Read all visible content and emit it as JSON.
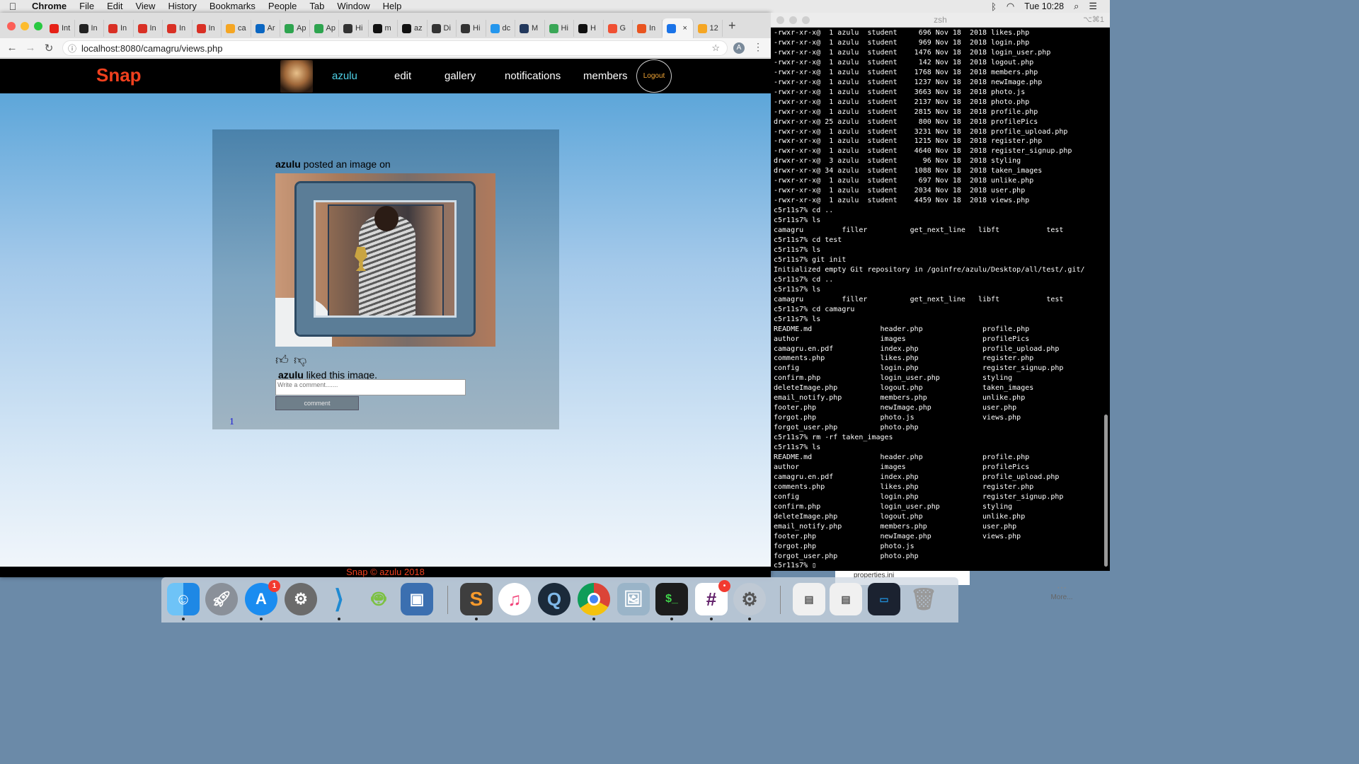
{
  "menubar": {
    "app": "Chrome",
    "items": [
      "File",
      "Edit",
      "View",
      "History",
      "Bookmarks",
      "People",
      "Tab",
      "Window",
      "Help"
    ],
    "clock": "Tue 10:28"
  },
  "browser": {
    "tabs": [
      {
        "label": "Int",
        "icon": "youtube-icon",
        "color": "#e62117"
      },
      {
        "label": "In",
        "icon": "42-icon",
        "color": "#222222"
      },
      {
        "label": "In",
        "icon": "gmail-icon",
        "color": "#d93025"
      },
      {
        "label": "In",
        "icon": "gmail-icon",
        "color": "#d93025"
      },
      {
        "label": "In",
        "icon": "gmail-icon",
        "color": "#d93025"
      },
      {
        "label": "In",
        "icon": "gmail-icon",
        "color": "#d93025"
      },
      {
        "label": "ca",
        "icon": "flame-icon",
        "color": "#f5a623"
      },
      {
        "label": "Ar",
        "icon": "linkedin-icon",
        "color": "#0a66c2"
      },
      {
        "label": "Ap",
        "icon": "h-icon",
        "color": "#2ea44f"
      },
      {
        "label": "Ap",
        "icon": "h-icon",
        "color": "#2ea44f"
      },
      {
        "label": "Hi",
        "icon": "circle-icon",
        "color": "#333333"
      },
      {
        "label": "m",
        "icon": "github-icon",
        "color": "#111111"
      },
      {
        "label": "az",
        "icon": "github-icon",
        "color": "#111111"
      },
      {
        "label": "Di",
        "icon": "circle-icon",
        "color": "#333333"
      },
      {
        "label": "Hi",
        "icon": "circle-icon",
        "color": "#333333"
      },
      {
        "label": "dc",
        "icon": "docker-icon",
        "color": "#2496ed"
      },
      {
        "label": "M",
        "icon": "m-icon",
        "color": "#23395d"
      },
      {
        "label": "Hi",
        "icon": "h-icon",
        "color": "#3aa757"
      },
      {
        "label": "H",
        "icon": "github-icon",
        "color": "#111111"
      },
      {
        "label": "G",
        "icon": "git-icon",
        "color": "#f05033"
      },
      {
        "label": "In",
        "icon": "ubuntu-icon",
        "color": "#e95420"
      },
      {
        "label": "",
        "icon": "refresh-icon",
        "color": "#1a73e8"
      },
      {
        "label": "12",
        "icon": "chart-icon",
        "color": "#f5a623"
      }
    ],
    "active_tab_close": "×",
    "new_tab": "+",
    "url": "localhost:8080/camagru/views.php",
    "profile_initial": "A"
  },
  "site": {
    "logo": "Snap",
    "nav": {
      "user": "azulu",
      "edit": "edit",
      "gallery": "gallery",
      "notifications": "notifications",
      "members": "members",
      "logout": "Logout"
    },
    "post": {
      "author": "azulu",
      "action": " posted an image on",
      "liker": "azulu",
      "liked_text": " liked this image.",
      "comment_placeholder": "Write a comment.......",
      "comment_button": "comment"
    },
    "page_number": "1",
    "footer": "Snap © azulu 2018",
    "colors": {
      "logo": "#f0401e",
      "active_nav": "#4fd2e8",
      "logout": "#f2a535"
    }
  },
  "terminal": {
    "title": "zsh",
    "shortcut": "⌥⌘1",
    "lines": [
      "-rwxr-xr-x@  1 azulu  student     696 Nov 18  2018 likes.php",
      "-rwxr-xr-x@  1 azulu  student     969 Nov 18  2018 login.php",
      "-rwxr-xr-x@  1 azulu  student    1476 Nov 18  2018 login_user.php",
      "-rwxr-xr-x@  1 azulu  student     142 Nov 18  2018 logout.php",
      "-rwxr-xr-x@  1 azulu  student    1768 Nov 18  2018 members.php",
      "-rwxr-xr-x@  1 azulu  student    1237 Nov 18  2018 newImage.php",
      "-rwxr-xr-x@  1 azulu  student    3663 Nov 18  2018 photo.js",
      "-rwxr-xr-x@  1 azulu  student    2137 Nov 18  2018 photo.php",
      "-rwxr-xr-x@  1 azulu  student    2815 Nov 18  2018 profile.php",
      "drwxr-xr-x@ 25 azulu  student     800 Nov 18  2018 profilePics",
      "-rwxr-xr-x@  1 azulu  student    3231 Nov 18  2018 profile_upload.php",
      "-rwxr-xr-x@  1 azulu  student    1215 Nov 18  2018 register.php",
      "-rwxr-xr-x@  1 azulu  student    4640 Nov 18  2018 register_signup.php",
      "drwxr-xr-x@  3 azulu  student      96 Nov 18  2018 styling",
      "drwxr-xr-x@ 34 azulu  student    1088 Nov 18  2018 taken_images",
      "-rwxr-xr-x@  1 azulu  student     697 Nov 18  2018 unlike.php",
      "-rwxr-xr-x@  1 azulu  student    2034 Nov 18  2018 user.php",
      "-rwxr-xr-x@  1 azulu  student    4459 Nov 18  2018 views.php",
      "c5r11s7% cd ..",
      "c5r11s7% ls",
      "camagru         filler          get_next_line   libft           test",
      "c5r11s7% cd test",
      "c5r11s7% ls",
      "c5r11s7% git init",
      "Initialized empty Git repository in /goinfre/azulu/Desktop/all/test/.git/",
      "c5r11s7% cd ..",
      "c5r11s7% ls",
      "camagru         filler          get_next_line   libft           test",
      "c5r11s7% cd camagru",
      "c5r11s7% ls",
      "README.md                header.php              profile.php",
      "author                   images                  profilePics",
      "camagru.en.pdf           index.php               profile_upload.php",
      "comments.php             likes.php               register.php",
      "config                   login.php               register_signup.php",
      "confirm.php              login_user.php          styling",
      "deleteImage.php          logout.php              taken_images",
      "email_notify.php         members.php             unlike.php",
      "footer.php               newImage.php            user.php",
      "forgot.php               photo.js                views.php",
      "forgot_user.php          photo.php",
      "c5r11s7% rm -rf taken_images",
      "c5r11s7% ls",
      "README.md                header.php              profile.php",
      "author                   images                  profilePics",
      "camagru.en.pdf           index.php               profile_upload.php",
      "comments.php             likes.php               register.php",
      "config                   login.php               register_signup.php",
      "confirm.php              login_user.php          styling",
      "deleteImage.php          logout.php              unlike.php",
      "email_notify.php         members.php             user.php",
      "footer.php               newImage.php            views.php",
      "forgot.php               photo.js",
      "forgot_user.php          photo.php",
      "c5r11s7% ▯"
    ]
  },
  "background": {
    "finder_item": "properties.ini",
    "more_label": "More..."
  },
  "dock": {
    "apps": [
      {
        "name": "finder",
        "badge": ""
      },
      {
        "name": "launchpad",
        "badge": ""
      },
      {
        "name": "app-store",
        "badge": "1"
      },
      {
        "name": "system-preferences",
        "badge": ""
      },
      {
        "name": "vscode",
        "badge": ""
      },
      {
        "name": "android-studio",
        "badge": ""
      },
      {
        "name": "virtualbox",
        "badge": ""
      },
      {
        "name": "sublime-text",
        "badge": ""
      },
      {
        "name": "itunes",
        "badge": ""
      },
      {
        "name": "quicktime",
        "badge": ""
      },
      {
        "name": "chrome",
        "badge": ""
      },
      {
        "name": "preview",
        "badge": ""
      },
      {
        "name": "terminal",
        "badge": ""
      },
      {
        "name": "slack",
        "badge": "•"
      },
      {
        "name": "settings-gear",
        "badge": ""
      }
    ]
  }
}
